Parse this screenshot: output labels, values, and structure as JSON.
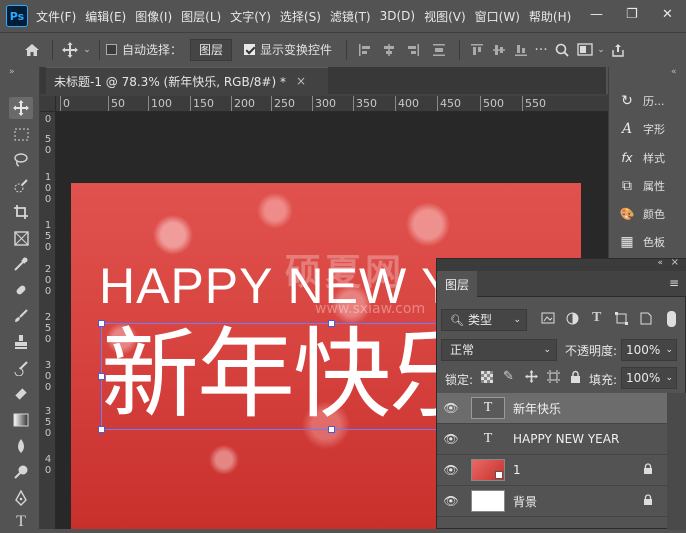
{
  "menubar": {
    "logo": "Ps",
    "items": [
      "文件(F)",
      "编辑(E)",
      "图像(I)",
      "图层(L)",
      "文字(Y)",
      "选择(S)",
      "滤镜(T)",
      "3D(D)",
      "视图(V)",
      "窗口(W)",
      "帮助(H)"
    ],
    "window_buttons": [
      "—",
      "❐",
      "✕"
    ]
  },
  "options": {
    "auto_select_label": "自动选择：",
    "auto_select_target": "图层",
    "show_transform_label": "显示变换控件"
  },
  "document": {
    "tab_title": "未标题-1 @ 78.3% (新年快乐, RGB/8#) *",
    "close_icon": "×",
    "headline": "HAPPY NEW YEAR",
    "cn_title": "新年快乐",
    "watermark": "硕夏网",
    "watermark_url": "www.sxiaw.com"
  },
  "rulers": {
    "horizontal": [
      "0",
      "50",
      "100",
      "150",
      "200",
      "250",
      "300",
      "350",
      "400",
      "450",
      "500",
      "550"
    ],
    "vertical": [
      "0",
      "5",
      "0",
      "1",
      "0",
      "0",
      "1",
      "5",
      "0",
      "2",
      "0",
      "0",
      "2",
      "5",
      "0",
      "3",
      "0",
      "0",
      "3",
      "5",
      "0",
      "4",
      "0"
    ]
  },
  "right_panel": {
    "items": [
      {
        "icon": "history-icon",
        "glyph": "↻",
        "label": "历..."
      },
      {
        "icon": "character-icon",
        "glyph": "A",
        "label": "字形"
      },
      {
        "icon": "styles-icon",
        "glyph": "fx",
        "label": "样式"
      },
      {
        "icon": "properties-icon",
        "glyph": "⧉",
        "label": "属性"
      },
      {
        "icon": "swatches-palette-icon",
        "glyph": "🎨",
        "label": "颜色"
      },
      {
        "icon": "grid-icon",
        "glyph": "▦",
        "label": "色板"
      }
    ]
  },
  "layers_panel": {
    "tab_label": "图层",
    "filter_type": "类型",
    "blend_mode": "正常",
    "opacity_label": "不透明度:",
    "opacity_value": "100%",
    "lock_label": "锁定:",
    "fill_label": "填充:",
    "fill_value": "100%",
    "layers": [
      {
        "name": "新年快乐",
        "kind": "text",
        "selected": true,
        "locked": false
      },
      {
        "name": "HAPPY NEW YEAR",
        "kind": "text",
        "selected": false,
        "locked": false
      },
      {
        "name": "1",
        "kind": "image",
        "selected": false,
        "locked": true
      },
      {
        "name": "背景",
        "kind": "background",
        "selected": false,
        "locked": true
      }
    ]
  },
  "colors": {
    "accent": "#31a8ff",
    "canvas_red": "#d84440",
    "panel_bg": "#535353"
  }
}
